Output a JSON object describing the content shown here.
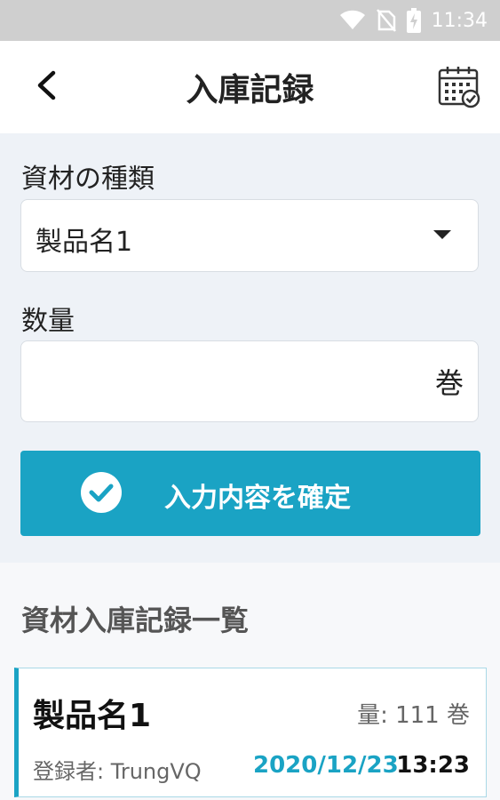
{
  "status_bar": {
    "time": "11:34"
  },
  "header": {
    "title": "入庫記録"
  },
  "form": {
    "material_label": "資材の種類",
    "material_selected": "製品名1",
    "quantity_label": "数量",
    "quantity_value": "",
    "quantity_unit": "巻",
    "confirm_label": "入力内容を確定"
  },
  "list": {
    "title": "資材入庫記録一覧",
    "items": [
      {
        "name": "製品名1",
        "quantity": "量: 111 巻",
        "registrant": "登録者: TrungVQ",
        "date": "2020/12/23",
        "time": "13:23"
      }
    ]
  },
  "colors": {
    "accent": "#1aa3c4",
    "statusbar": "#cfcfcf",
    "form_bg": "#eef2f7"
  }
}
